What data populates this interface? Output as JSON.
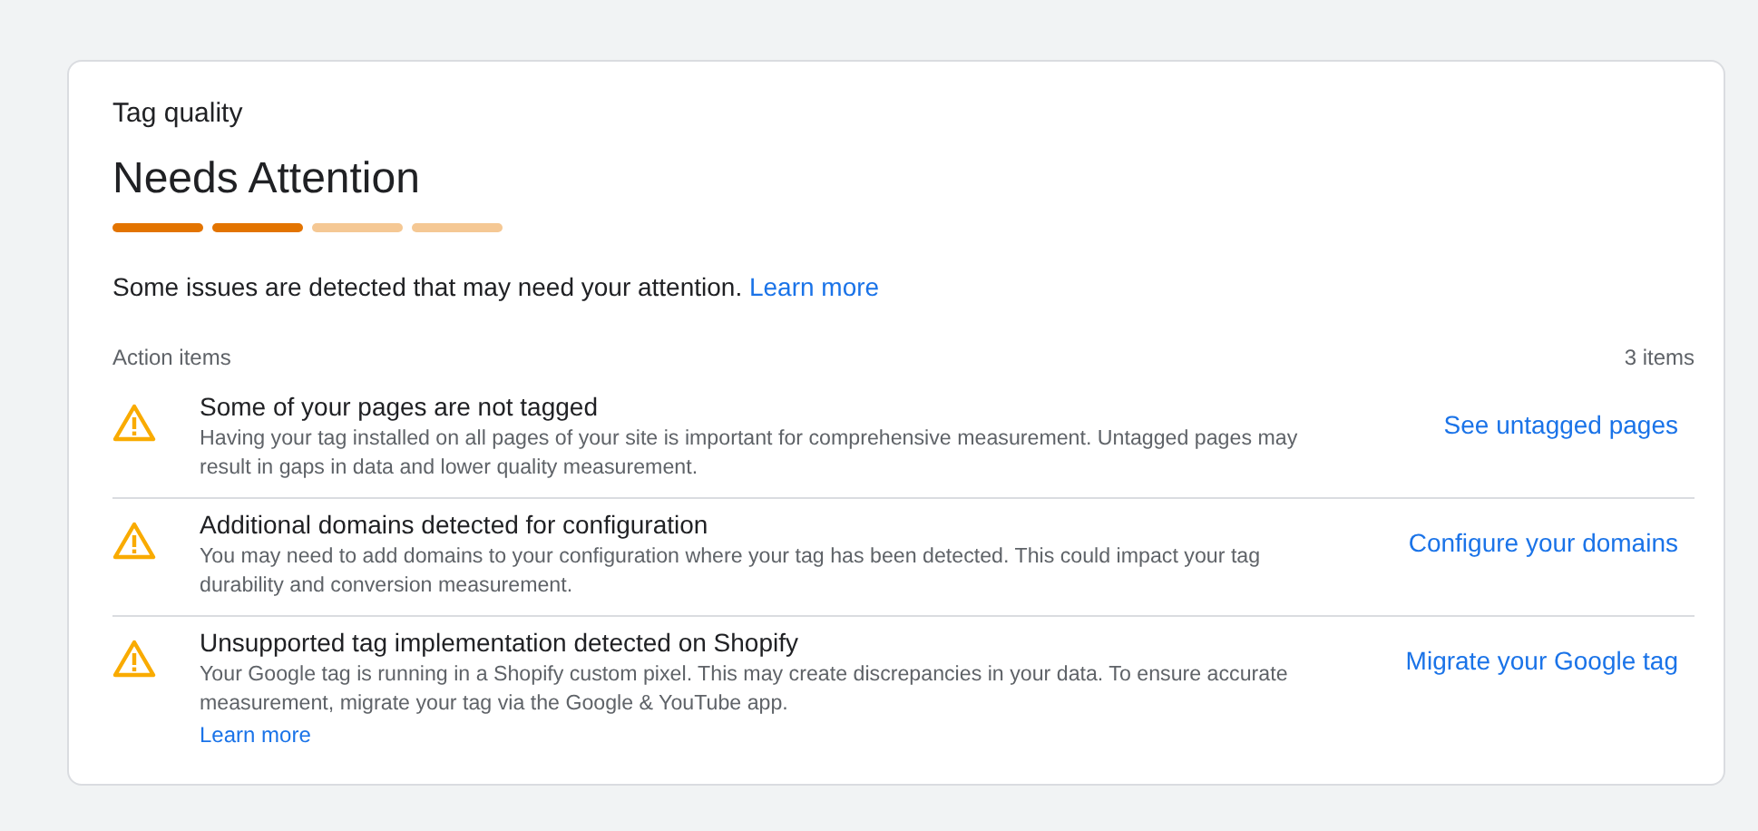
{
  "card": {
    "subtitle": "Tag quality",
    "status": "Needs Attention",
    "meter": [
      {
        "filled": true
      },
      {
        "filled": true
      },
      {
        "filled": false
      },
      {
        "filled": false
      }
    ],
    "summary": "Some issues are detected that may need your attention.",
    "summary_link": "Learn more",
    "list_label": "Action items",
    "count": "3 items",
    "items": [
      {
        "title": "Some of your pages are not tagged",
        "description": "Having your tag installed on all pages of your site is important for comprehensive measurement. Untagged pages may result in gaps in data and lower quality measurement.",
        "action": "See untagged pages"
      },
      {
        "title": "Additional domains detected for configuration",
        "description": "You may need to add domains to your configuration where your tag has been detected. This could impact your tag durability and conversion measurement.",
        "action": "Configure your domains"
      },
      {
        "title": "Unsupported tag implementation detected on Shopify",
        "description": "Your Google tag is running in a Shopify custom pixel. This may create discrepancies in your data. To ensure accurate measurement, migrate your tag via the Google & YouTube app.",
        "learn_more": "Learn more",
        "action": "Migrate your Google tag"
      }
    ]
  }
}
